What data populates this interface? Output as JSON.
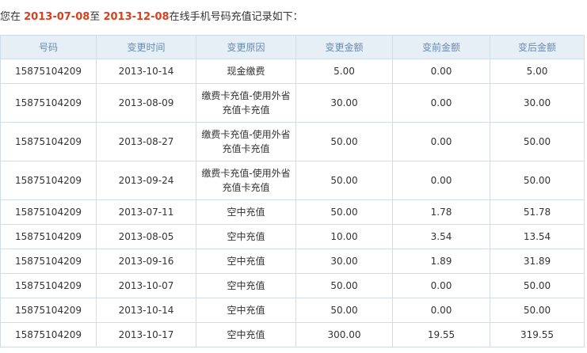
{
  "summary": {
    "prefix": "您在 ",
    "start_date": "2013-07-08",
    "middle": "至 ",
    "end_date": "2013-12-08",
    "suffix": "在线手机号码充值记录如下："
  },
  "colors": {
    "date_highlight": "#d9401f",
    "header_bg": "#e6eef6",
    "header_text": "#6a8bb0",
    "border": "#cfdde9"
  },
  "table": {
    "headers": [
      "号码",
      "变更时间",
      "变更原因",
      "变更金额",
      "变前金额",
      "变后金额"
    ],
    "rows": [
      [
        "15875104209",
        "2013-10-14",
        "现金缴费",
        "5.00",
        "0.00",
        "5.00"
      ],
      [
        "15875104209",
        "2013-08-09",
        "缴费卡充值-使用外省充值卡充值",
        "30.00",
        "0.00",
        "30.00"
      ],
      [
        "15875104209",
        "2013-08-27",
        "缴费卡充值-使用外省充值卡充值",
        "50.00",
        "0.00",
        "50.00"
      ],
      [
        "15875104209",
        "2013-09-24",
        "缴费卡充值-使用外省充值卡充值",
        "50.00",
        "0.00",
        "50.00"
      ],
      [
        "15875104209",
        "2013-07-11",
        "空中充值",
        "50.00",
        "1.78",
        "51.78"
      ],
      [
        "15875104209",
        "2013-08-05",
        "空中充值",
        "10.00",
        "3.54",
        "13.54"
      ],
      [
        "15875104209",
        "2013-09-16",
        "空中充值",
        "30.00",
        "1.89",
        "31.89"
      ],
      [
        "15875104209",
        "2013-10-07",
        "空中充值",
        "50.00",
        "0.00",
        "50.00"
      ],
      [
        "15875104209",
        "2013-10-14",
        "空中充值",
        "50.00",
        "0.00",
        "50.00"
      ],
      [
        "15875104209",
        "2013-10-17",
        "空中充值",
        "300.00",
        "19.55",
        "319.55"
      ]
    ]
  }
}
